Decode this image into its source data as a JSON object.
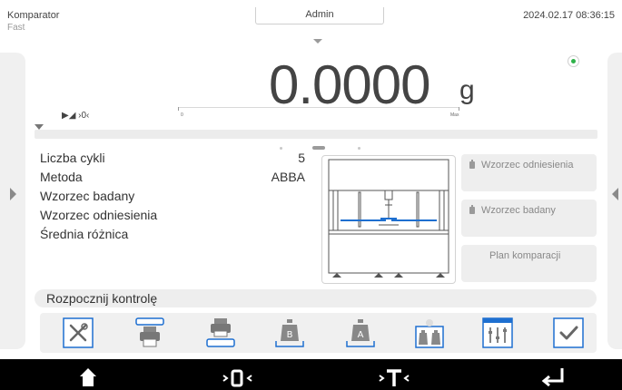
{
  "header": {
    "title": "Komparator",
    "mode": "Fast",
    "user": "Admin",
    "datetime": "2024.02.17 08:36:15"
  },
  "weighing": {
    "value": "0.0000",
    "unit": "g",
    "status_color": "#2fb24a",
    "stability_indicator": "▶◢ ›0‹",
    "range_min": "0",
    "range_max": "Max"
  },
  "info": {
    "rows": [
      {
        "label": "Liczba cykli",
        "value": "5"
      },
      {
        "label": "Metoda",
        "value": "ABBA"
      },
      {
        "label": "Wzorzec badany",
        "value": ""
      },
      {
        "label": "Wzorzec odniesienia",
        "value": ""
      },
      {
        "label": "Średnia różnica",
        "value": ""
      }
    ]
  },
  "buttons": {
    "reference_standard": "Wzorzec odniesienia",
    "test_standard": "Wzorzec badany",
    "comparison_plan": "Plan komparacji",
    "start_control": "Rozpocznij kontrolę"
  },
  "toolbar": {
    "icons": [
      "tools-icon",
      "printer-header-icon",
      "printer-footer-icon",
      "weight-b-icon",
      "weight-a-icon",
      "weights-ab-icon",
      "calendar-settings-icon",
      "confirm-check-icon"
    ]
  },
  "bottom_bar": {
    "icons": [
      "home-icon",
      "zero-icon",
      "tare-icon",
      "enter-icon"
    ]
  },
  "colors": {
    "accent_blue": "#1e6fd0",
    "panel_gray": "#eeeeee",
    "bottom_bar": "#000000"
  }
}
